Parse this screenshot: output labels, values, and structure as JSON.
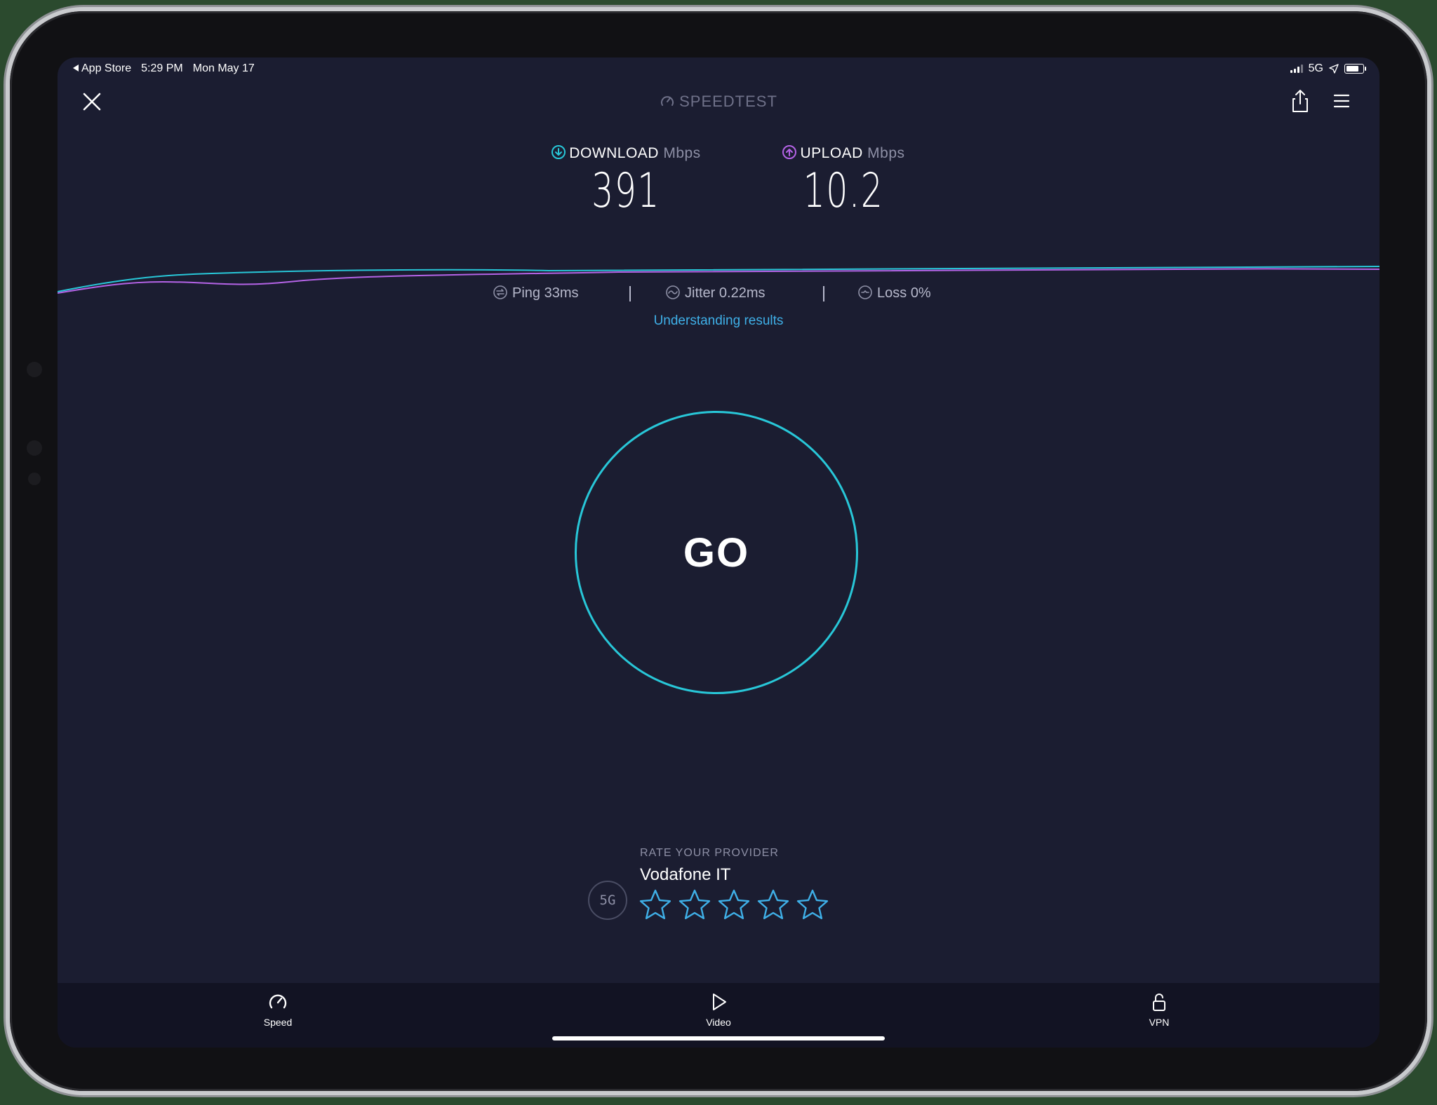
{
  "status_bar": {
    "back_app": "App Store",
    "time": "5:29 PM",
    "date": "Mon May 17",
    "network": "5G",
    "battery_level": 0.85
  },
  "header": {
    "title": "SPEEDTEST"
  },
  "download": {
    "label": "DOWNLOAD",
    "unit": "Mbps",
    "value": "391",
    "color": "#28c7d8"
  },
  "upload": {
    "label": "UPLOAD",
    "unit": "Mbps",
    "value": "10.2",
    "color": "#b463e6"
  },
  "ping": {
    "label": "Ping",
    "value": "33ms"
  },
  "jitter": {
    "label": "Jitter",
    "value": "0.22ms"
  },
  "loss": {
    "label": "Loss",
    "value": "0%"
  },
  "links": {
    "understanding": "Understanding results"
  },
  "go_button": {
    "label": "GO",
    "ring_color": "#28c7d8"
  },
  "provider": {
    "prompt": "RATE YOUR PROVIDER",
    "name": "Vodafone IT",
    "badge": "5G",
    "rating_max": 5,
    "rating": 0
  },
  "tabs": [
    {
      "label": "Speed",
      "icon": "speedometer-icon"
    },
    {
      "label": "Video",
      "icon": "play-icon"
    },
    {
      "label": "VPN",
      "icon": "unlock-icon"
    }
  ],
  "colors": {
    "background": "#1b1d31",
    "accent": "#3fb0e8"
  }
}
